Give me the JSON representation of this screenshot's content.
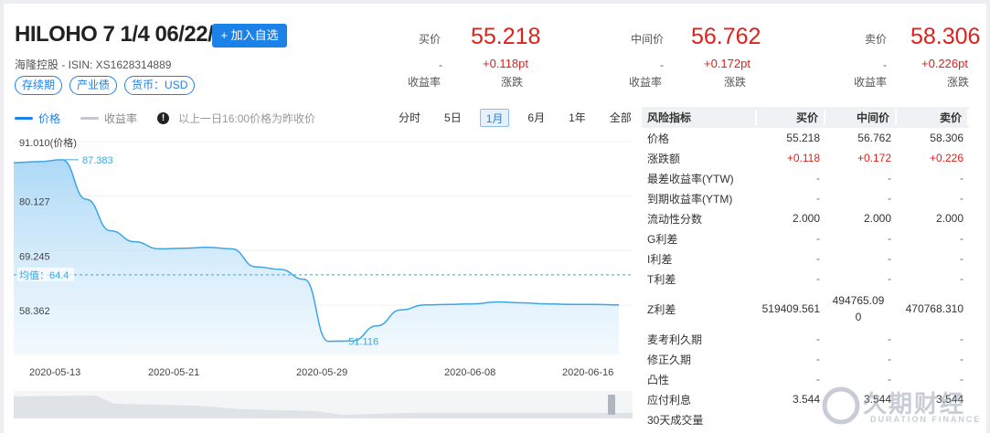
{
  "header": {
    "bond_name": "HILOHO 7 1/4 06/22/20",
    "add_button": "+ 加入自选",
    "issuer_line": "海隆控股 - ISIN:  XS1628314889",
    "tags": [
      "存续期",
      "产业债",
      "货币：USD"
    ]
  },
  "quotes": {
    "bid": {
      "label": "买价",
      "price": "55.218",
      "yield": "-",
      "yield_label": "收益率",
      "change": "+0.118pt",
      "change_label": "涨跌"
    },
    "mid": {
      "label": "中间价",
      "price": "56.762",
      "yield": "-",
      "yield_label": "收益率",
      "change": "+0.172pt",
      "change_label": "涨跌"
    },
    "ask": {
      "label": "卖价",
      "price": "58.306",
      "yield": "-",
      "yield_label": "收益率",
      "change": "+0.226pt",
      "change_label": "涨跌"
    }
  },
  "chart_toolbar": {
    "legend_price": "价格",
    "legend_yield": "收益率",
    "notice": "以上一日16:00价格为昨收价",
    "periods": [
      "分时",
      "5日",
      "1月",
      "6月",
      "1年",
      "全部"
    ],
    "active_period": "1月"
  },
  "colors": {
    "accent": "#1c82e8",
    "up": "#e0201b",
    "line": "#3aa6e6"
  },
  "chart_data": {
    "type": "area",
    "series": [
      {
        "name": "价格",
        "x": [
          "2020-05-13",
          "2020-05-14",
          "2020-05-15",
          "2020-05-18",
          "2020-05-19",
          "2020-05-20",
          "2020-05-21",
          "2020-05-22",
          "2020-05-25",
          "2020-05-26",
          "2020-05-27",
          "2020-05-28",
          "2020-05-29",
          "2020-06-01",
          "2020-06-02",
          "2020-06-03",
          "2020-06-04",
          "2020-06-05",
          "2020-06-08",
          "2020-06-09",
          "2020-06-10",
          "2020-06-11",
          "2020-06-12",
          "2020-06-15",
          "2020-06-16",
          "2020-06-17"
        ],
        "values": [
          86.8,
          87.0,
          87.383,
          79.5,
          73.2,
          71.0,
          69.6,
          69.7,
          69.9,
          69.6,
          66.0,
          65.5,
          63.5,
          51.116,
          51.2,
          54.2,
          57.4,
          58.4,
          58.5,
          58.6,
          59.0,
          58.8,
          58.6,
          58.5,
          58.5,
          58.4
        ]
      }
    ],
    "yticks": [
      "91.010(价格)",
      "80.127",
      "69.245",
      "58.362"
    ],
    "ylim": [
      48.5,
      91.01
    ],
    "xticks": [
      "2020-05-13",
      "2020-05-21",
      "2020-05-29",
      "2020-06-08",
      "2020-06-16"
    ],
    "max_label": "87.383",
    "min_label": "51.116",
    "avg_label": "均值：64.4",
    "avg_value": 64.4,
    "grid": true
  },
  "risk_table": {
    "headers": [
      "风险指标",
      "买价",
      "中间价",
      "卖价"
    ],
    "rows": [
      {
        "name": "价格",
        "bid": "55.218",
        "mid": "56.762",
        "ask": "58.306",
        "red": false
      },
      {
        "name": "涨跌额",
        "bid": "+0.118",
        "mid": "+0.172",
        "ask": "+0.226",
        "red": true
      },
      {
        "name": "最差收益率(YTW)",
        "bid": "-",
        "mid": "-",
        "ask": "-",
        "red": false
      },
      {
        "name": "到期收益率(YTM)",
        "bid": "-",
        "mid": "-",
        "ask": "-",
        "red": false
      },
      {
        "name": "流动性分数",
        "bid": "2.000",
        "mid": "2.000",
        "ask": "2.000",
        "red": false
      },
      {
        "name": "G利差",
        "bid": "-",
        "mid": "-",
        "ask": "-",
        "red": false
      },
      {
        "name": "I利差",
        "bid": "-",
        "mid": "-",
        "ask": "-",
        "red": false
      },
      {
        "name": "T利差",
        "bid": "-",
        "mid": "-",
        "ask": "-",
        "red": false
      },
      {
        "name": "Z利差",
        "bid": "519409.561",
        "mid": "494765.09\n0",
        "ask": "470768.310",
        "red": false,
        "tall": true
      },
      {
        "name": "麦考利久期",
        "bid": "-",
        "mid": "-",
        "ask": "-",
        "red": false
      },
      {
        "name": "修正久期",
        "bid": "-",
        "mid": "-",
        "ask": "-",
        "red": false
      },
      {
        "name": "凸性",
        "bid": "-",
        "mid": "-",
        "ask": "-",
        "red": false
      },
      {
        "name": "应付利息",
        "bid": "3.544",
        "mid": "3.544",
        "ask": "3.544",
        "red": false
      },
      {
        "name": "30天成交量",
        "bid": "",
        "mid": "",
        "ask": "",
        "red": false
      }
    ]
  },
  "watermark": {
    "main": "久期财经",
    "sub": "DURATION FINANCE"
  }
}
